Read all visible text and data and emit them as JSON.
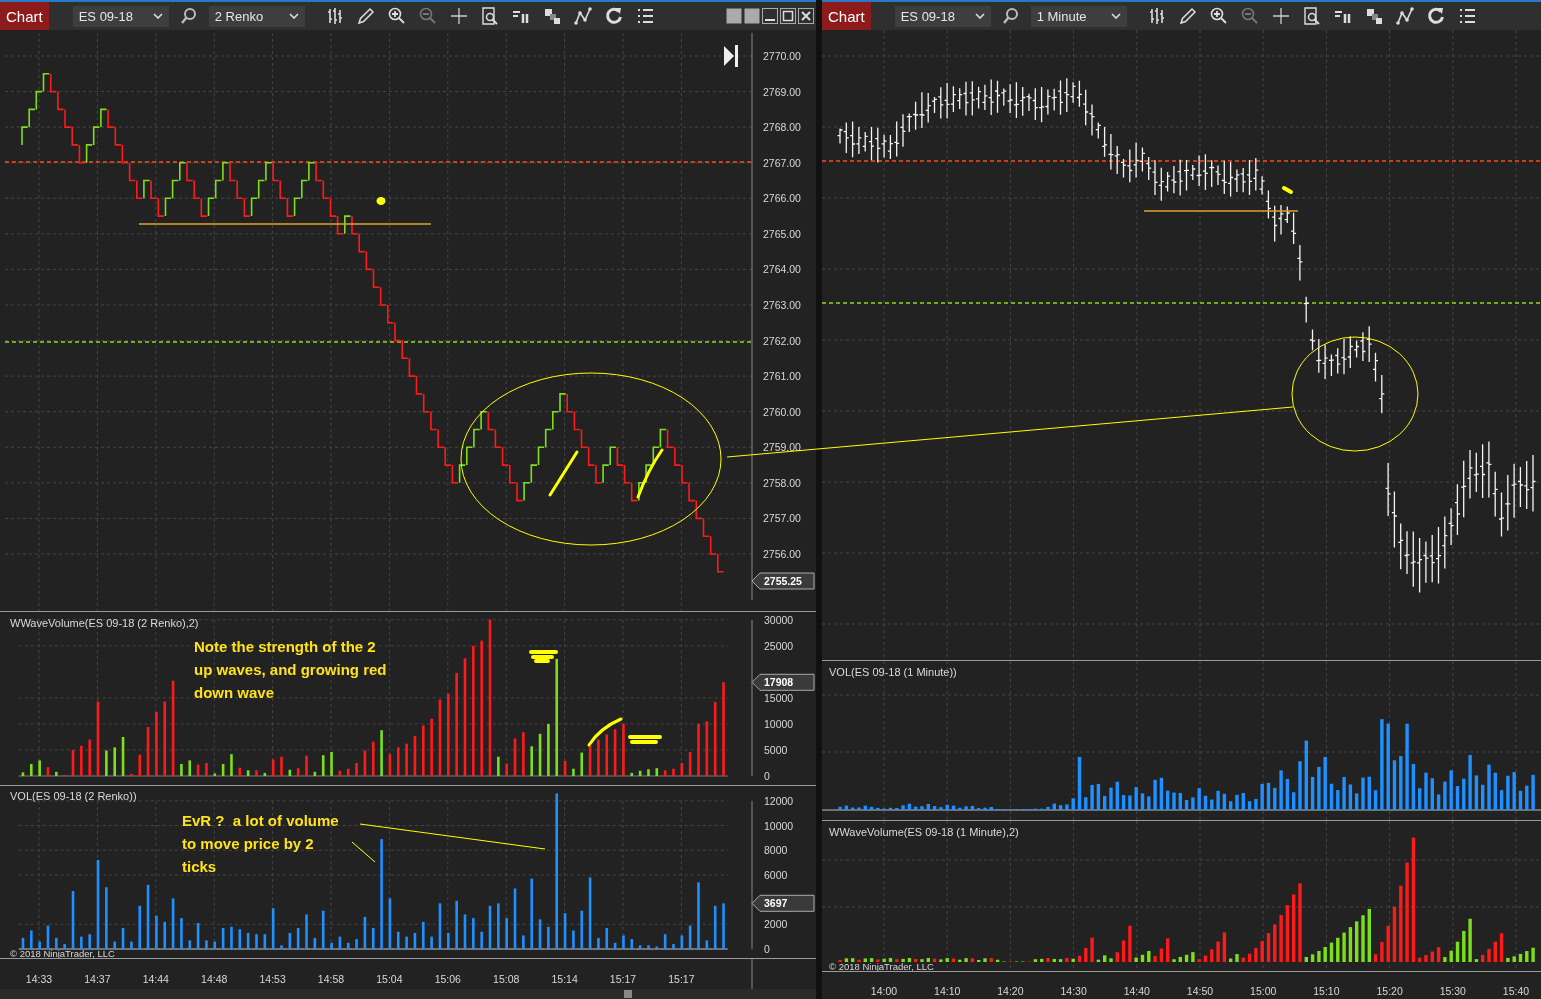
{
  "left_window": {
    "chart_button": "Chart",
    "instrument": "ES 09-18",
    "interval": "2 Renko",
    "price_panel": {
      "axis_labels": [
        "2770.00",
        "2769.00",
        "2768.00",
        "2767.00",
        "2766.00",
        "2765.00",
        "2764.00",
        "2763.00",
        "2762.00",
        "2761.00",
        "2760.00",
        "2759.00",
        "2758.00",
        "2757.00",
        "2756.00"
      ],
      "last_price": "2755.25"
    },
    "wave_panel": {
      "title": "WWaveVolume(ES 09-18 (2 Renko),2)",
      "note": "Note the strength of the 2 up waves, and growing red down wave",
      "badge": "17908",
      "chart_data": {
        "type": "bar",
        "grid": true,
        "ylim": [
          0,
          31500
        ],
        "yticks": [
          0,
          5000,
          10000,
          15000,
          25000,
          30000
        ],
        "series": [
          {
            "color": "#7ddf1b",
            "values": [
              700,
              2300,
              3000,
              null,
              800,
              null,
              null,
              null,
              null,
              null,
              4900,
              5500,
              7500,
              null,
              null,
              null,
              null,
              null,
              null,
              2300,
              3000,
              null,
              null,
              500,
              2300,
              4200,
              null,
              1100,
              null,
              600,
              null,
              null,
              1200,
              null,
              null,
              800,
              4000,
              4600,
              null,
              null,
              null,
              null,
              null,
              8800,
              null,
              null,
              null,
              null,
              null,
              null,
              null,
              null,
              null,
              null,
              null,
              null,
              null,
              3700,
              null,
              null,
              null,
              5700,
              8100,
              10000,
              22500,
              null,
              1400,
              4500,
              null,
              null,
              null,
              null,
              null,
              600,
              1000,
              1300,
              1500,
              null,
              null,
              null,
              null,
              null,
              null,
              null,
              null
            ]
          },
          {
            "color": "#ff1a1a",
            "values": [
              null,
              null,
              null,
              1700,
              null,
              200,
              5000,
              5800,
              7000,
              14300,
              null,
              null,
              null,
              400,
              4100,
              9400,
              12300,
              14300,
              18300,
              null,
              null,
              2200,
              2500,
              null,
              null,
              null,
              1600,
              null,
              1100,
              null,
              3200,
              3700,
              null,
              1500,
              3900,
              null,
              null,
              null,
              1000,
              1400,
              2500,
              4900,
              6600,
              null,
              4200,
              5500,
              6200,
              7700,
              9700,
              11000,
              14700,
              15800,
              19800,
              22600,
              25000,
              26000,
              30000,
              null,
              2400,
              7200,
              8400,
              null,
              null,
              null,
              null,
              2900,
              null,
              null,
              5800,
              7000,
              8000,
              9000,
              10000,
              null,
              null,
              null,
              null,
              1100,
              1400,
              2500,
              4600,
              10000,
              10500,
              14200,
              18000
            ]
          }
        ]
      }
    },
    "volume_panel": {
      "title": "VOL(ES 09-18 (2 Renko))",
      "note": "EvR ?  a lot of volume to move price by 2 ticks",
      "badge": "3697",
      "copyright": "© 2018 NinjaTrader, LLC",
      "chart_data": {
        "type": "bar",
        "grid": true,
        "ylim": [
          0,
          13200
        ],
        "yticks": [
          0,
          2000,
          6000,
          8000,
          10000,
          12000
        ],
        "series": [
          {
            "color": "#1e90ff",
            "values": [
              900,
              1500,
              600,
              1900,
              900,
              400,
              4700,
              1000,
              1200,
              7200,
              5000,
              600,
              1700,
              600,
              3500,
              5200,
              2700,
              2200,
              4100,
              2500,
              700,
              2100,
              700,
              600,
              1700,
              1800,
              1600,
              1300,
              1200,
              1200,
              3300,
              300,
              1300,
              1700,
              2800,
              900,
              3100,
              500,
              1000,
              500,
              800,
              2600,
              1700,
              8900,
              4100,
              1400,
              1000,
              1300,
              2200,
              1000,
              3700,
              1300,
              3900,
              2800,
              2500,
              1400,
              3500,
              3700,
              2500,
              4900,
              1100,
              5700,
              2400,
              1800,
              12600,
              2900,
              1500,
              3100,
              5800,
              900,
              1700,
              500,
              1100,
              800,
              300,
              300,
              200,
              1200,
              400,
              1100,
              1900,
              5400,
              700,
              3500,
              3700
            ]
          }
        ]
      }
    },
    "time_labels": [
      "14:33",
      "14:37",
      "14:44",
      "14:48",
      "14:53",
      "14:58",
      "15:04",
      "15:06",
      "15:08",
      "15:14",
      "15:17",
      "15:17"
    ]
  },
  "right_window": {
    "chart_button": "Chart",
    "instrument": "ES 09-18",
    "interval": "1 Minute",
    "volume_panel": {
      "title": "VOL(ES 09-18 (1 Minute))"
    },
    "wave_panel": {
      "title": "WWaveVolume(ES 09-18 (1 Minute),2)",
      "copyright": "© 2018 NinjaTrader, LLC"
    },
    "time_labels": [
      "14:00",
      "14:10",
      "14:20",
      "14:30",
      "14:40",
      "14:50",
      "15:00",
      "15:10",
      "15:20",
      "15:30",
      "15:40"
    ]
  }
}
